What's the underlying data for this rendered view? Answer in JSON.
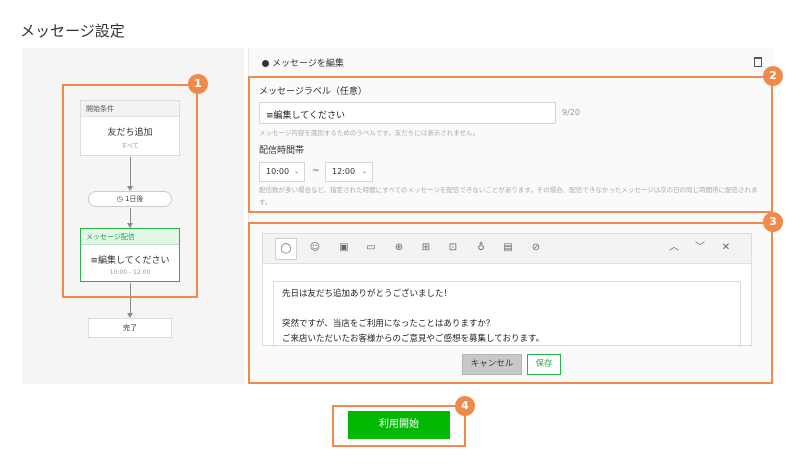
{
  "page_title": "メッセージ設定",
  "flow": {
    "start_head": "開始条件",
    "start_main": "友だち追加",
    "start_sub": "すべて",
    "delay": "1日後",
    "message_head": "メッセージ配信",
    "message_main": "≡編集してください",
    "message_sub": "10:00 - 12:00",
    "end": "完了"
  },
  "editor_panel": {
    "header_title": "メッセージを編集",
    "label_field_label": "メッセージラベル（任意）",
    "label_value": "≡編集してください",
    "char_count": "9/20",
    "label_help": "メッセージ内容を識別するためのラベルです。友だちには表示されません。",
    "time_label": "配信時間帯",
    "time_from": "10:00",
    "time_to": "12:00",
    "tilde": "~",
    "time_help": "配信数が多い場合など、指定された時間にすべてのメッセージを配信できないことがあります。その場合、配信できなかったメッセージは次の日の同じ時間帯に配信されます。",
    "message_lines": [
      "先日は友だち追加ありがとうございました！",
      "",
      "突然ですが、当店をご利用になったことはありますか？",
      "ご来店いただいたお客様からのご意見やご感想を募集しております。"
    ],
    "cancel_label": "キャンセル",
    "save_label": "保存"
  },
  "start_button_label": "利用開始",
  "callouts": [
    "1",
    "2",
    "3",
    "4"
  ],
  "colors": {
    "accent_orange": "#f08a4b",
    "line_green": "#00b900",
    "message_green": "#27b34a"
  },
  "toolbar_icons": [
    "speech-bubble-icon",
    "sticker-icon",
    "image-icon",
    "video-icon",
    "coupon-icon",
    "richmessage-icon",
    "richvideo-icon",
    "audio-icon",
    "survey-icon",
    "cardtype-icon",
    "move-up-icon",
    "move-down-icon",
    "close-icon"
  ]
}
